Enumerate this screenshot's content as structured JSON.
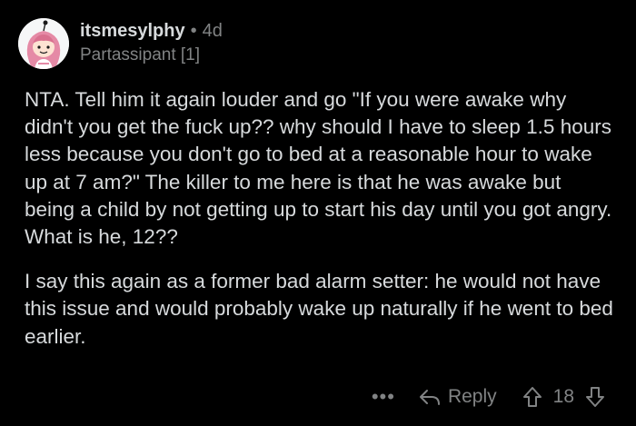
{
  "comment": {
    "username": "itsmesylphy",
    "separator": "•",
    "age": "4d",
    "flair": "Partassipant [1]",
    "paragraphs": [
      "NTA. Tell him it again louder and go \"If you were awake why didn't you get the fuck up?? why should I have to sleep 1.5 hours less because you don't go to bed at a reasonable hour to wake up at 7 am?\" The killer to me here is that he was awake but being a child by not getting up to start his day until you got angry. What is he, 12??",
      "I say this again as a former bad alarm setter: he would not have this issue and would probably wake up naturally if he went to bed earlier."
    ]
  },
  "actions": {
    "more_label": "•••",
    "reply_label": "Reply",
    "score": "18"
  },
  "icons": {
    "more": "more-icon",
    "reply": "reply-icon",
    "upvote": "upvote-icon",
    "downvote": "downvote-icon",
    "avatar": "avatar"
  },
  "colors": {
    "background": "#000000",
    "text": "#d7dadc",
    "muted": "#818384",
    "avatar_hair": "#e58aa6"
  }
}
